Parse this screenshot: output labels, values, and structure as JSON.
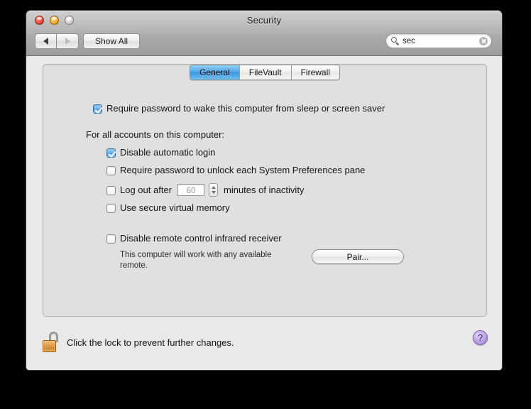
{
  "window": {
    "title": "Security",
    "traffic_lights": [
      {
        "name": "close",
        "label": "close"
      },
      {
        "name": "minimize",
        "label": "minimize"
      },
      {
        "name": "zoom",
        "label": "zoom"
      }
    ]
  },
  "toolbar": {
    "back_icon": "back-arrow-icon",
    "forward_icon": "forward-arrow-icon",
    "show_all_label": "Show All"
  },
  "search": {
    "icon": "search-icon",
    "value": "sec",
    "placeholder": "Search",
    "clear_icon": "clear-icon"
  },
  "tabs": [
    {
      "label": "General",
      "selected": true
    },
    {
      "label": "FileVault",
      "selected": false
    },
    {
      "label": "Firewall",
      "selected": false
    }
  ],
  "general": {
    "require_password_wake": {
      "label": "Require password to wake this computer from sleep or screen saver",
      "checked": true
    },
    "accounts_section_label": "For all accounts on this computer:",
    "options": [
      {
        "label": "Disable automatic login",
        "checked": true
      },
      {
        "label": "Require password to unlock each System Preferences pane",
        "checked": false
      },
      {
        "label": "Log out after",
        "checked": false
      },
      {
        "label": "Use secure virtual memory",
        "checked": false
      }
    ],
    "logout_minutes": "60",
    "logout_suffix": "minutes of inactivity",
    "stepper_up_icon": "stepper-up-icon",
    "stepper_down_icon": "stepper-down-icon",
    "remote": {
      "label": "Disable remote control infrared receiver",
      "checked": false,
      "note": "This computer will work with any available remote.",
      "pair_label": "Pair..."
    }
  },
  "footer": {
    "lock_icon": "unlocked-padlock-icon",
    "lock_text": "Click the lock to prevent further changes.",
    "help_label": "?"
  },
  "colors": {
    "accent_tab": "#4c9ce4",
    "checkbox_checked": "#4c9ce4",
    "help_button": "#9f7bd3",
    "lock_gold": "#e59c42",
    "window_bg": "#e9e9e9",
    "groupbox_bg": "#e0e0e0"
  }
}
